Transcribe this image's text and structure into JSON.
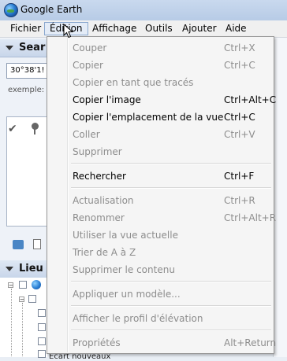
{
  "window": {
    "title": "Google Earth"
  },
  "menubar": {
    "items": [
      "Fichier",
      "Édition",
      "Affichage",
      "Outils",
      "Ajouter",
      "Aide"
    ]
  },
  "search_panel": {
    "header": "Sear",
    "input_value": "30°38'1!",
    "example_label": "exemple:"
  },
  "places_panel": {
    "header": "Lieu"
  },
  "background_text": "Ecart nouveaux",
  "edit_menu": {
    "groups": [
      [
        {
          "label": "Couper",
          "shortcut": "Ctrl+X",
          "enabled": false
        },
        {
          "label": "Copier",
          "shortcut": "Ctrl+C",
          "enabled": false
        },
        {
          "label": "Copier en tant que tracés",
          "shortcut": "",
          "enabled": false
        },
        {
          "label": "Copier l'image",
          "shortcut": "Ctrl+Alt+C",
          "enabled": true
        },
        {
          "label": "Copier l'emplacement de la vue",
          "shortcut": "Ctrl+C",
          "enabled": true
        },
        {
          "label": "Coller",
          "shortcut": "Ctrl+V",
          "enabled": false
        },
        {
          "label": "Supprimer",
          "shortcut": "",
          "enabled": false
        }
      ],
      [
        {
          "label": "Rechercher",
          "shortcut": "Ctrl+F",
          "enabled": true
        }
      ],
      [
        {
          "label": "Actualisation",
          "shortcut": "Ctrl+R",
          "enabled": false
        },
        {
          "label": "Renommer",
          "shortcut": "Ctrl+Alt+R",
          "enabled": false
        },
        {
          "label": "Utiliser la vue actuelle",
          "shortcut": "",
          "enabled": false
        },
        {
          "label": "Trier de A à Z",
          "shortcut": "",
          "enabled": false
        },
        {
          "label": "Supprimer le contenu",
          "shortcut": "",
          "enabled": false
        }
      ],
      [
        {
          "label": "Appliquer un modèle...",
          "shortcut": "",
          "enabled": false
        }
      ],
      [
        {
          "label": "Afficher le profil d'élévation",
          "shortcut": "",
          "enabled": false
        }
      ],
      [
        {
          "label": "Propriétés",
          "shortcut": "Alt+Return",
          "enabled": false
        }
      ]
    ]
  },
  "colors": {
    "titlebar": "#c9d9ee",
    "menu_bg": "#f5f5f5",
    "disabled_text": "#8d8d8d",
    "open_menu_highlight": "#e4ecf7"
  }
}
